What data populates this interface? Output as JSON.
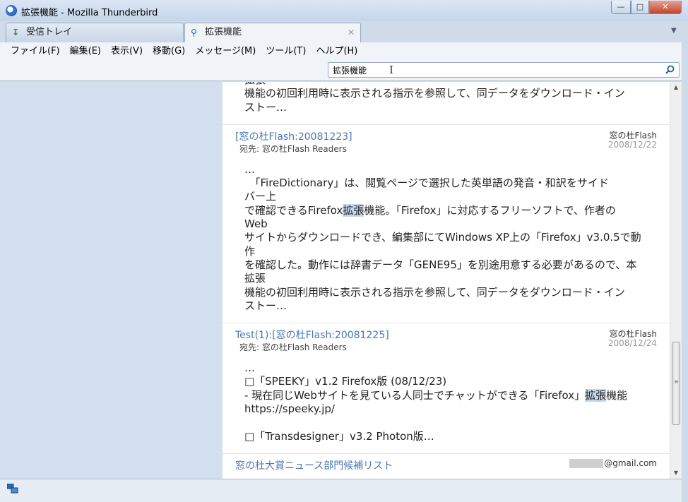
{
  "window": {
    "title": "拡張機能 - Mozilla Thunderbird"
  },
  "tabs": [
    {
      "label": "受信トレイ",
      "icon": "download-icon",
      "active": false
    },
    {
      "label": "拡張機能",
      "icon": "search-icon",
      "active": true
    }
  ],
  "menu": [
    "ファイル(F)",
    "編集(E)",
    "表示(V)",
    "移動(G)",
    "メッセージ(M)",
    "ツール(T)",
    "ヘルプ(H)"
  ],
  "search": {
    "value": "拡張機能"
  },
  "top_fragment": {
    "lines": [
      "拡張",
      "機能の初回利用時に表示される指示を参照して、同データをダウンロード・イン",
      "ストー…"
    ]
  },
  "results": [
    {
      "subject": "[窓の杜Flash:20081223]",
      "to": "宛先: 窓の杜Flash Readers",
      "from": "窓の杜Flash",
      "date": "2008/12/22",
      "body": [
        "…",
        "　「FireDictionary」は、閲覧ページで選択した英単語の発音・和訳をサイド",
        "バー上",
        "で確認できるFirefox拡張機能。「Firefox」に対応するフリーソフトで、作者の",
        "Web",
        "サイトからダウンロードでき、編集部にてWindows XP上の「Firefox」v3.0.5で動",
        "作",
        "を確認した。動作には辞書データ「GENE95」を別途用意する必要があるので、本",
        "拡張",
        "機能の初回利用時に表示される指示を参照して、同データをダウンロード・イン",
        "ストー…"
      ]
    },
    {
      "subject": "Test(1):[窓の杜Flash:20081225]",
      "to": "宛先: 窓の杜Flash Readers",
      "from": "窓の杜Flash",
      "date": "2008/12/24",
      "body": [
        "…",
        "□「SPEEKY」v1.2 Firefox版 (08/12/23)",
        "- 現在同じWebサイトを見ている人同士でチャットができる「Firefox」拡張機能",
        "https://speeky.jp/",
        "",
        "□「Transdesigner」v3.2 Photon版…"
      ]
    },
    {
      "subject": "窓の杜大賞ニュース部門候補リスト",
      "from": "@gmail.com"
    }
  ],
  "highlight_term": "拡張"
}
